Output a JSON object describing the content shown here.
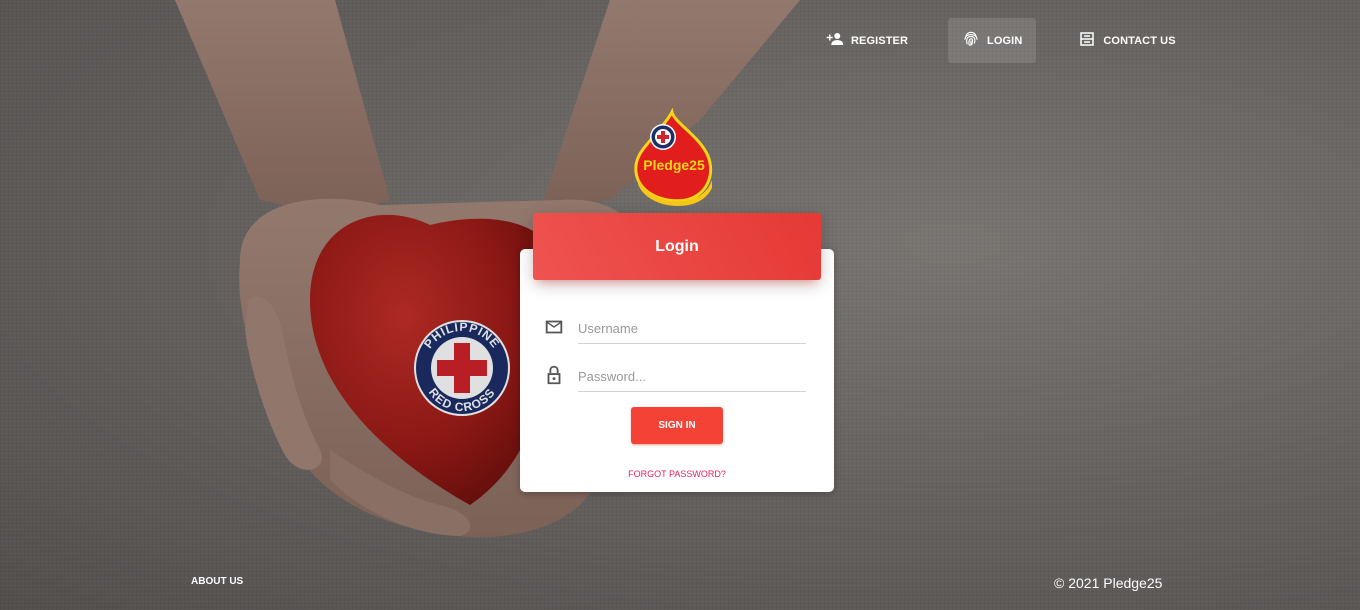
{
  "nav": {
    "items": [
      {
        "label": "REGISTER",
        "icon": "person-add-icon"
      },
      {
        "label": "LOGIN",
        "icon": "fingerprint-icon"
      },
      {
        "label": "CONTACT US",
        "icon": "contact-icon"
      }
    ]
  },
  "logo": {
    "text": "Pledge25"
  },
  "background": {
    "heart_badge_top": "PHILIPPINE",
    "heart_badge_bottom": "RED CROSS"
  },
  "card": {
    "title": "Login",
    "username_placeholder": "Username",
    "password_placeholder": "Password...",
    "signin_label": "SIGN IN",
    "forgot_label": "FORGOT PASSWORD?"
  },
  "footer": {
    "about_label": "ABOUT US",
    "copyright": "© 2021 Pledge25"
  },
  "colors": {
    "accent": "#f44336",
    "header_gradient_start": "#ef5350",
    "header_gradient_end": "#e53935",
    "link": "#e91e63"
  }
}
